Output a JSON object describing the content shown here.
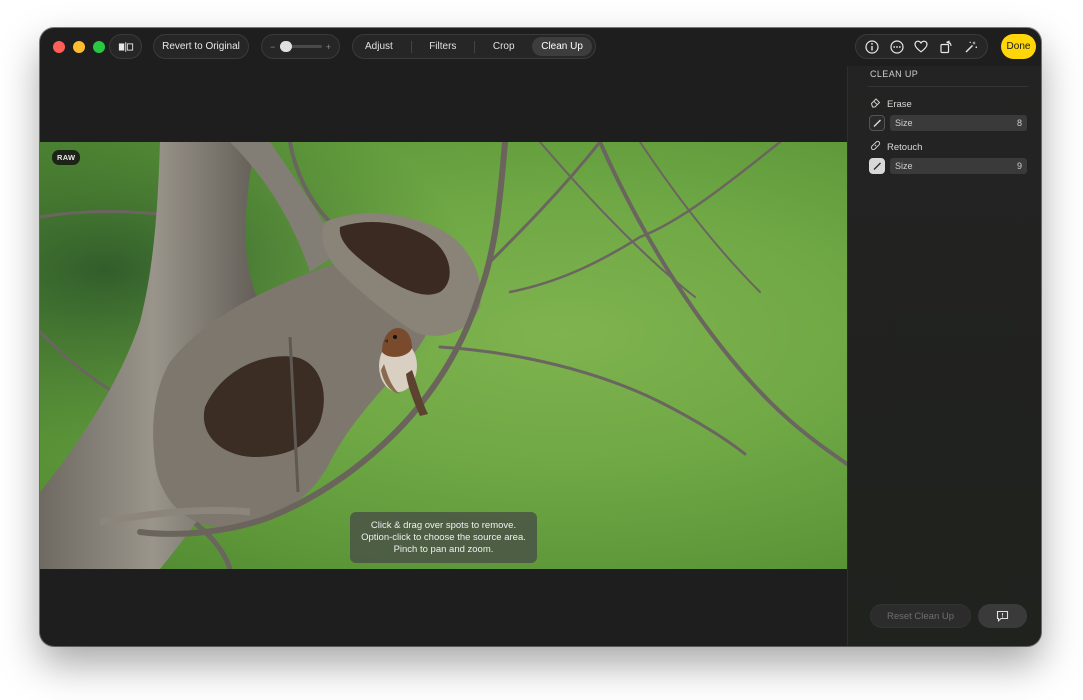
{
  "toolbar": {
    "compare_icon": "split-compare-icon",
    "revert_label": "Revert to Original",
    "zoom_minus": "−",
    "zoom_plus": "+",
    "zoom_level": 0,
    "tabs": [
      {
        "label": "Adjust"
      },
      {
        "label": "Filters"
      },
      {
        "label": "Crop"
      },
      {
        "label": "Clean Up",
        "active": true
      }
    ],
    "right_icons": [
      "info-icon",
      "more-icon",
      "heart-icon",
      "rotate-icon",
      "magic-wand-icon"
    ],
    "done_label": "Done",
    "done_color": "#ffd60a"
  },
  "photo": {
    "badge": "RAW",
    "hint_lines": [
      "Click & drag over spots to remove.",
      "Option-click to choose the source area.",
      "Pinch to pan and zoom."
    ]
  },
  "sidebar": {
    "title": "CLEAN UP",
    "erase": {
      "label": "Erase",
      "size_label": "Size",
      "size_value": "8"
    },
    "retouch": {
      "label": "Retouch",
      "size_label": "Size",
      "size_value": "9"
    },
    "reset_label": "Reset Clean Up",
    "feedback_icon": "feedback-icon"
  }
}
